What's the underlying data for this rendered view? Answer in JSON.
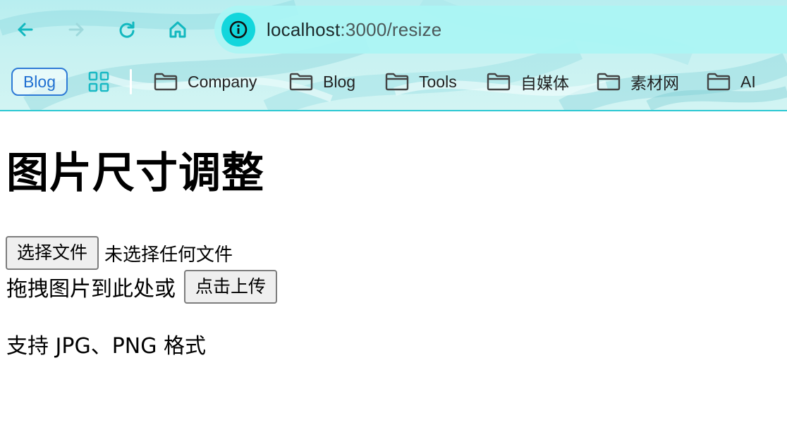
{
  "browser": {
    "url_host": "localhost",
    "url_rest": ":3000/resize",
    "accent_color": "#12d6dc",
    "nav_icons": [
      "back-arrow-icon",
      "forward-arrow-icon",
      "reload-icon",
      "home-icon"
    ],
    "bookmarks": {
      "badge_label": "Blog",
      "folders": [
        "Company",
        "Blog",
        "Tools",
        "自媒体",
        "素材网",
        "AI"
      ]
    }
  },
  "page": {
    "title": "图片尺寸调整",
    "file_button_label": "选择文件",
    "file_status": "未选择任何文件",
    "drop_text": "拖拽图片到此处或",
    "upload_button_label": "点击上传",
    "support_text": "支持 JPG、PNG 格式"
  }
}
